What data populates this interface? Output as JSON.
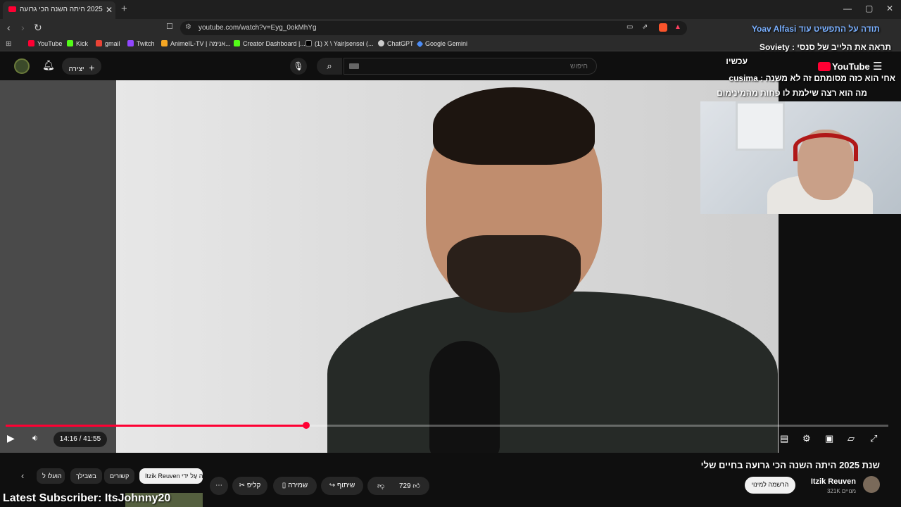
{
  "browser": {
    "tab_title": "שנת 2025 היתה השנה הכי גרועה",
    "tab_close": "✕",
    "new_tab": "+",
    "url": "youtube.com/watch?v=Eyg_0okMhYg",
    "window_controls": [
      "—",
      "▢",
      "✕"
    ],
    "bookmarks": [
      {
        "label": "YouTube",
        "color": "#ff0033"
      },
      {
        "label": "Kick",
        "color": "#53fc18"
      },
      {
        "label": "gmail",
        "color": "#ea4335"
      },
      {
        "label": "Twitch",
        "color": "#9146ff"
      },
      {
        "label": "AnimeIL-TV | אנימה...",
        "color": "#f5a623"
      },
      {
        "label": "Creator Dashboard |...",
        "color": "#53fc18"
      },
      {
        "label": "(1) X \\ Yair|sensei (...",
        "color": "#000000"
      },
      {
        "label": "ChatGPT",
        "color": "#cccccc"
      },
      {
        "label": "Google Gemini",
        "color": "#4c8df6"
      }
    ]
  },
  "header": {
    "create_label": "יצירה",
    "search_placeholder": "חיפוש",
    "logo_text": "YouTube"
  },
  "player": {
    "time": "14:16 / 41:55",
    "progress_fraction": 0.3405
  },
  "stream": {
    "chat_lines": [
      {
        "text": "תודה על התפשיט עוד Yoav Alfasi"
      },
      {
        "text": "תראה את הלייב של סנסי : Soviety"
      },
      {
        "text": "עכשיו"
      },
      {
        "text": "אחי הוא כזה מסומתם זה לא משנה : cusima"
      },
      {
        "text": "מה הוא רצה שילמת לו פחות מהמינימום"
      }
    ],
    "latest_subscriber": "Latest Subscriber: ItsJohnny20"
  },
  "video": {
    "title": "שנת 2025 היתה השנה הכי גרועה בחיים שלי",
    "channel_name": "Itzik Reuven",
    "channel_subs": "321K מנויים",
    "subscribe_label": "הרשמה למינוי",
    "likes": "729",
    "share_label": "שיתוף",
    "save_label": "שמירה",
    "clip_label": "קליפ",
    "more_label": "⋯"
  },
  "chips": [
    {
      "label": "Itzik Reuven ה עַל ידי",
      "active": true
    },
    {
      "label": "קשורים",
      "active": false
    },
    {
      "label": "בשבילך",
      "active": false
    },
    {
      "label": "הועלו ל",
      "active": false
    }
  ]
}
